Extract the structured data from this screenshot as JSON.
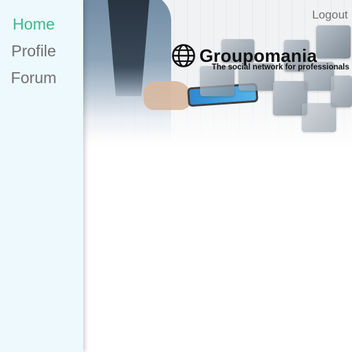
{
  "nav": {
    "items": [
      {
        "label": "Home",
        "active": true
      },
      {
        "label": "Profile",
        "active": false
      },
      {
        "label": "Forum",
        "active": false
      }
    ],
    "active_color": "#3cb88c",
    "inactive_color": "#707070"
  },
  "header": {
    "logout_label": "Logout"
  },
  "banner": {
    "brand_name": "Groupomania",
    "tagline": "The social network for professionals",
    "logo_icon": "globe-icon"
  },
  "colors": {
    "sidebar_bg": "#eef9fe",
    "main_bg": "#ffffff"
  }
}
